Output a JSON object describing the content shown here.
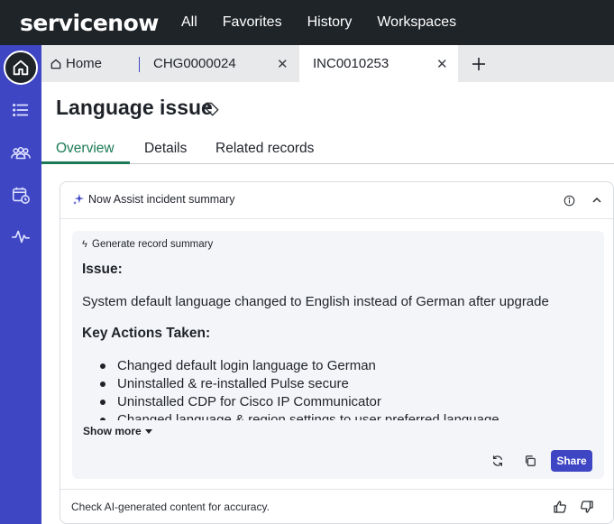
{
  "topnav": {
    "logo": "servicenow",
    "links": [
      "All",
      "Favorites",
      "History",
      "Workspaces"
    ]
  },
  "tabs": [
    {
      "label": "Home"
    },
    {
      "label": "CHG0000024"
    },
    {
      "label": "INC0010253"
    }
  ],
  "record": {
    "title": "Language issue",
    "tabs": [
      "Overview",
      "Details",
      "Related records"
    ]
  },
  "assist": {
    "title": "Now Assist incident summary",
    "generate_label": "Generate record summary",
    "issue_heading": "Issue:",
    "issue_text": "System default language changed to English instead of German after upgrade",
    "actions_heading": "Key Actions Taken:",
    "actions": [
      "Changed default login language to German",
      "Uninstalled & re-installed Pulse secure",
      "Uninstalled CDP for Cisco IP Communicator",
      "Changed language & region settings to user preferred language"
    ],
    "show_more": "Show more",
    "share_label": "Share",
    "disclaimer": "Check AI-generated content for accuracy."
  },
  "colors": {
    "nav_bg": "#1f2428",
    "sidebar_bg": "#3e46c4",
    "active_tab_accent": "#1c7a56",
    "share_button": "#3e46c4"
  },
  "icons": [
    "home-icon",
    "list-icon",
    "people-icon",
    "calendar-clock-icon",
    "pulse-icon",
    "tag-icon",
    "sparkle-icon",
    "info-icon",
    "chevron-up-icon",
    "refresh-icon",
    "copy-icon",
    "thumbs-up-icon",
    "thumbs-down-icon",
    "close-icon",
    "plus-icon"
  ]
}
